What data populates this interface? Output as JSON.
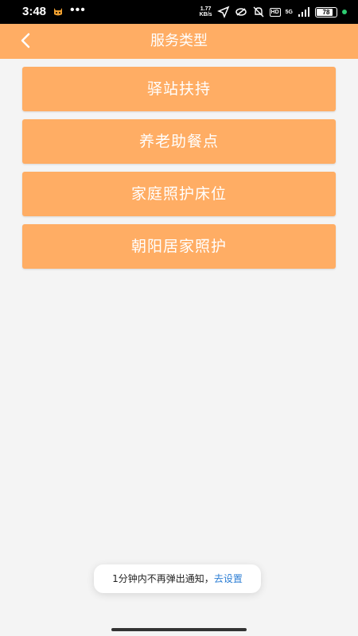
{
  "status_bar": {
    "time": "3:48",
    "net_speed_value": "1.77",
    "net_speed_unit": "KB/s",
    "hd_label": "HD",
    "network_label": "5G",
    "battery_level": "78"
  },
  "header": {
    "title": "服务类型"
  },
  "services": [
    {
      "label": "驿站扶持"
    },
    {
      "label": "养老助餐点"
    },
    {
      "label": "家庭照护床位"
    },
    {
      "label": "朝阳居家照护"
    }
  ],
  "toast": {
    "message": "1分钟内不再弹出通知，",
    "link": "去设置"
  },
  "colors": {
    "accent": "#ffad64",
    "background": "#f4f4f4",
    "link": "#2c7ed4"
  }
}
